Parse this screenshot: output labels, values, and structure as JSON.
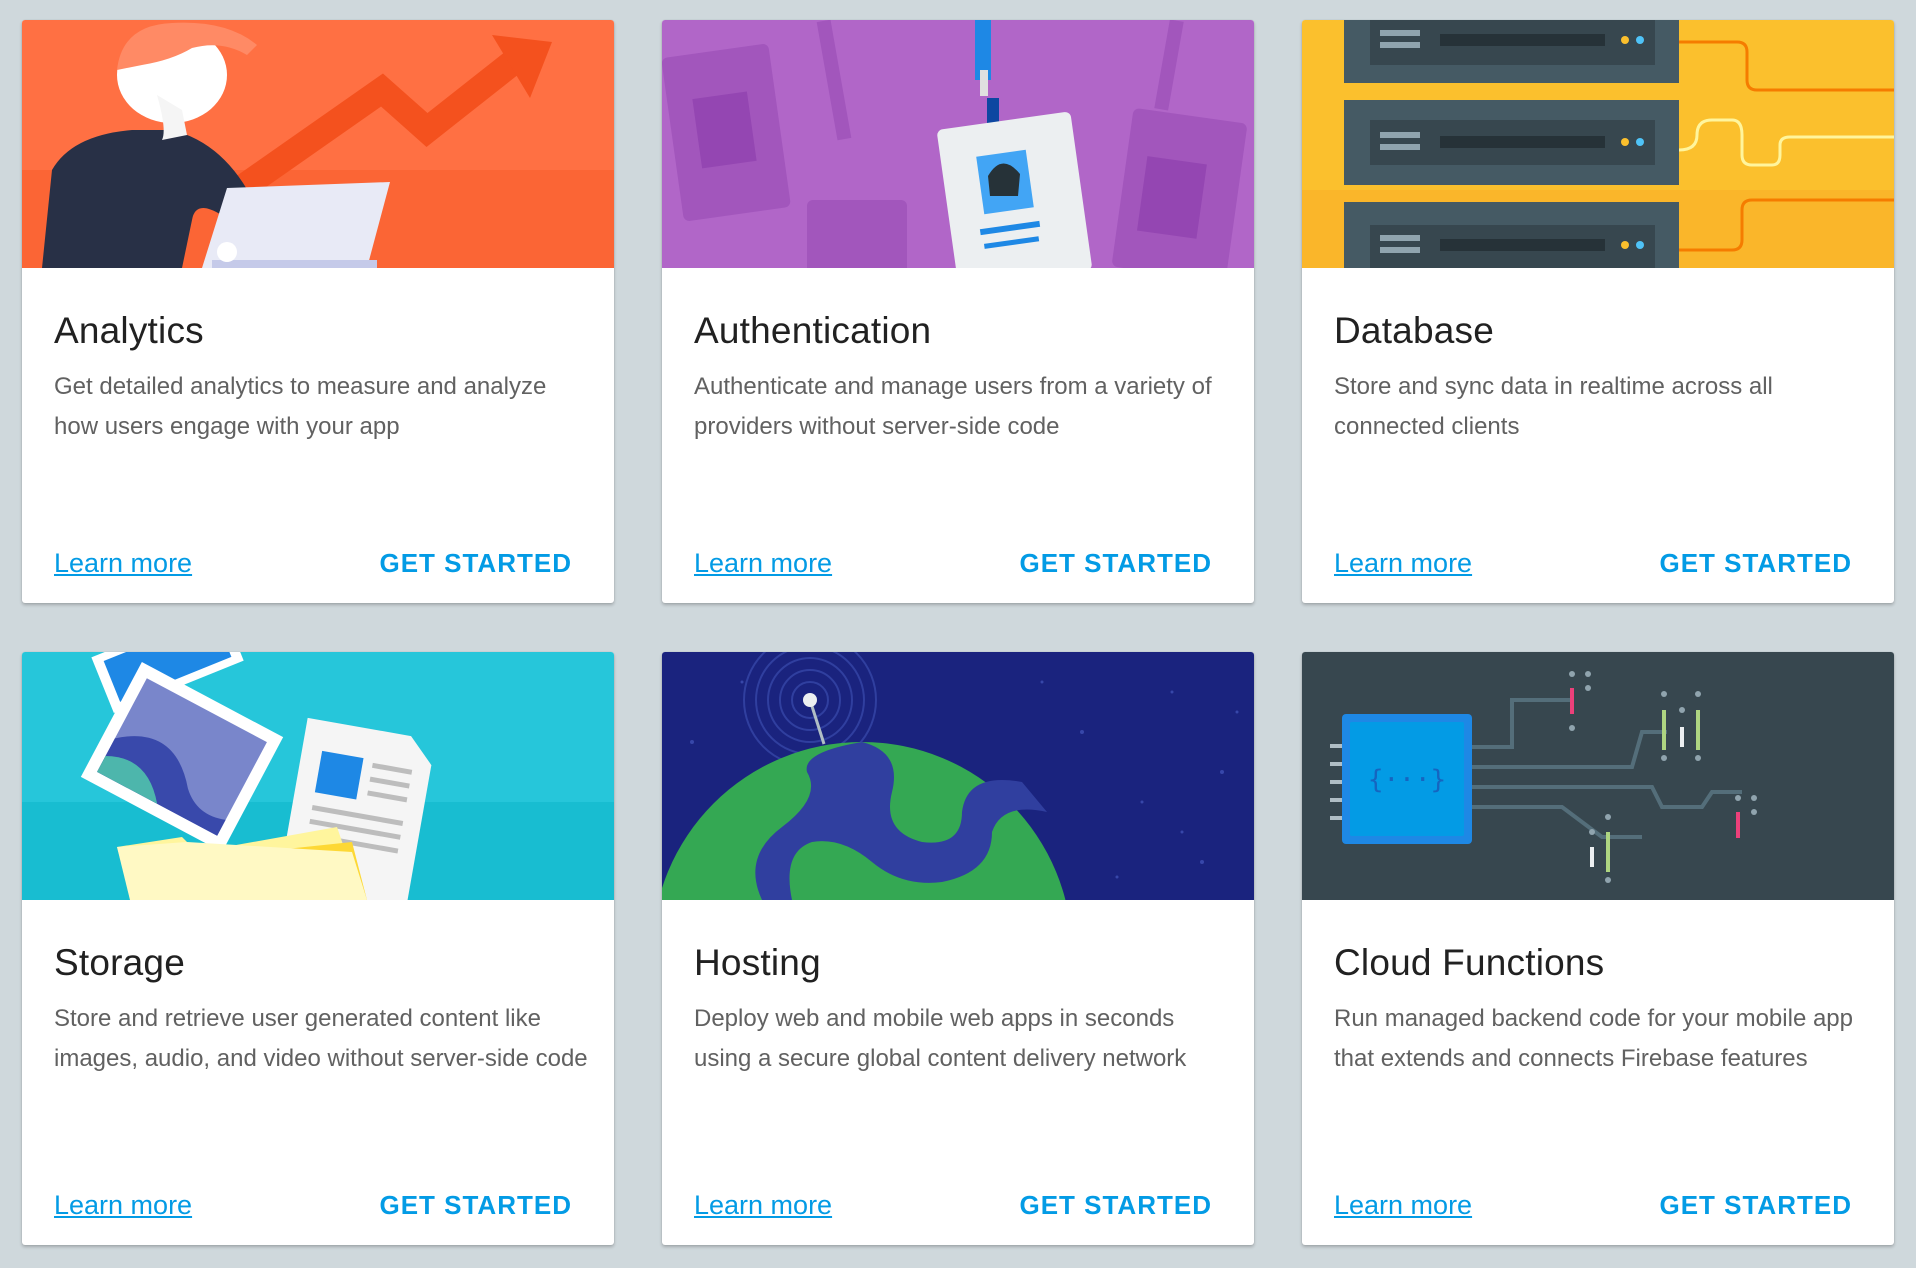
{
  "colors": {
    "accent": "#039be5",
    "analytics_bg": "#ff7043",
    "authentication_bg": "#b166c8",
    "database_bg": "#fbc02d",
    "storage_bg": "#26c6da",
    "hosting_bg": "#1a237e",
    "functions_bg": "#37474f"
  },
  "cards": [
    {
      "title": "Analytics",
      "description": "Get detailed analytics to measure and analyze how users engage with your app",
      "learn_more": "Learn more",
      "get_started": "GET STARTED",
      "illustration": "person-laptop-trend-illustration"
    },
    {
      "title": "Authentication",
      "description": "Authenticate and manage users from a variety of providers without server-side code",
      "learn_more": "Learn more",
      "get_started": "GET STARTED",
      "illustration": "id-badge-illustration"
    },
    {
      "title": "Database",
      "description": "Store and sync data in realtime across all connected clients",
      "learn_more": "Learn more",
      "get_started": "GET STARTED",
      "illustration": "server-racks-illustration"
    },
    {
      "title": "Storage",
      "description": "Store and retrieve user generated content like images, audio, and video without server-side code",
      "learn_more": "Learn more",
      "get_started": "GET STARTED",
      "illustration": "photos-documents-folder-illustration"
    },
    {
      "title": "Hosting",
      "description": "Deploy web and mobile web apps in seconds using a secure global content delivery network",
      "learn_more": "Learn more",
      "get_started": "GET STARTED",
      "illustration": "globe-antenna-illustration"
    },
    {
      "title": "Cloud Functions",
      "description": "Run managed backend code for your mobile app that extends and connects Firebase features",
      "learn_more": "Learn more",
      "get_started": "GET STARTED",
      "illustration": "chip-circuit-illustration"
    }
  ]
}
